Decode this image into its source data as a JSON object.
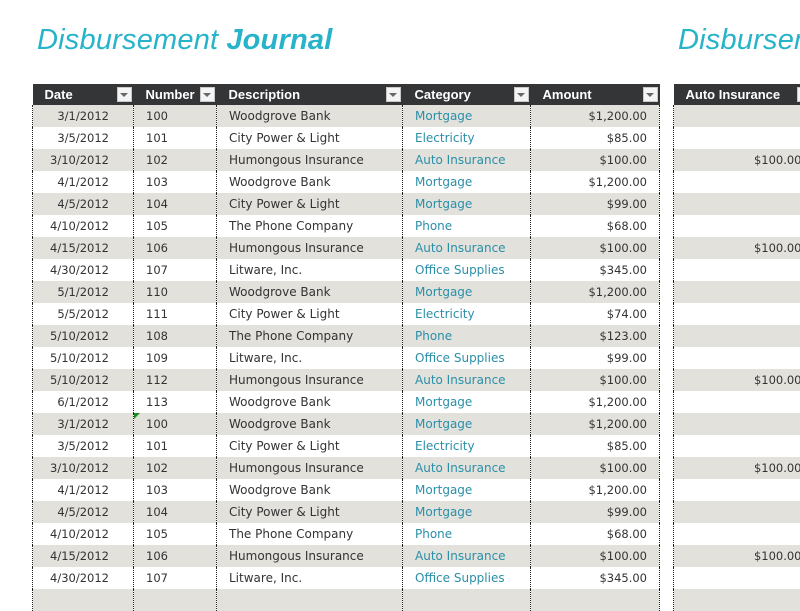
{
  "title": {
    "light": "Disbursement",
    "bold": "Journal"
  },
  "title_second": {
    "light": "Disbursement",
    "bold": ""
  },
  "journal": {
    "columns": [
      "Date",
      "Number",
      "Description",
      "Category",
      "Amount"
    ],
    "rows": [
      {
        "date": "3/1/2012",
        "number": "100",
        "description": "Woodgrove Bank",
        "category": "Mortgage",
        "amount": "$1,200.00"
      },
      {
        "date": "3/5/2012",
        "number": "101",
        "description": "City Power & Light",
        "category": "Electricity",
        "amount": "$85.00"
      },
      {
        "date": "3/10/2012",
        "number": "102",
        "description": "Humongous Insurance",
        "category": "Auto Insurance",
        "amount": "$100.00"
      },
      {
        "date": "4/1/2012",
        "number": "103",
        "description": "Woodgrove Bank",
        "category": "Mortgage",
        "amount": "$1,200.00"
      },
      {
        "date": "4/5/2012",
        "number": "104",
        "description": "City Power & Light",
        "category": "Mortgage",
        "amount": "$99.00"
      },
      {
        "date": "4/10/2012",
        "number": "105",
        "description": "The Phone Company",
        "category": "Phone",
        "amount": "$68.00"
      },
      {
        "date": "4/15/2012",
        "number": "106",
        "description": "Humongous Insurance",
        "category": "Auto Insurance",
        "amount": "$100.00"
      },
      {
        "date": "4/30/2012",
        "number": "107",
        "description": "Litware, Inc.",
        "category": "Office Supplies",
        "amount": "$345.00"
      },
      {
        "date": "5/1/2012",
        "number": "110",
        "description": "Woodgrove Bank",
        "category": "Mortgage",
        "amount": "$1,200.00"
      },
      {
        "date": "5/5/2012",
        "number": "111",
        "description": "City Power & Light",
        "category": "Electricity",
        "amount": "$74.00"
      },
      {
        "date": "5/10/2012",
        "number": "108",
        "description": "The Phone Company",
        "category": "Phone",
        "amount": "$123.00"
      },
      {
        "date": "5/10/2012",
        "number": "109",
        "description": "Litware, Inc.",
        "category": "Office Supplies",
        "amount": "$99.00"
      },
      {
        "date": "5/10/2012",
        "number": "112",
        "description": "Humongous Insurance",
        "category": "Auto Insurance",
        "amount": "$100.00"
      },
      {
        "date": "6/1/2012",
        "number": "113",
        "description": "Woodgrove Bank",
        "category": "Mortgage",
        "amount": "$1,200.00"
      },
      {
        "date": "3/1/2012",
        "number": "100",
        "description": "Woodgrove Bank",
        "category": "Mortgage",
        "amount": "$1,200.00",
        "error_flag": true
      },
      {
        "date": "3/5/2012",
        "number": "101",
        "description": "City Power & Light",
        "category": "Electricity",
        "amount": "$85.00"
      },
      {
        "date": "3/10/2012",
        "number": "102",
        "description": "Humongous Insurance",
        "category": "Auto Insurance",
        "amount": "$100.00"
      },
      {
        "date": "4/1/2012",
        "number": "103",
        "description": "Woodgrove Bank",
        "category": "Mortgage",
        "amount": "$1,200.00"
      },
      {
        "date": "4/5/2012",
        "number": "104",
        "description": "City Power & Light",
        "category": "Mortgage",
        "amount": "$99.00"
      },
      {
        "date": "4/10/2012",
        "number": "105",
        "description": "The Phone Company",
        "category": "Phone",
        "amount": "$68.00"
      },
      {
        "date": "4/15/2012",
        "number": "106",
        "description": "Humongous Insurance",
        "category": "Auto Insurance",
        "amount": "$100.00"
      },
      {
        "date": "4/30/2012",
        "number": "107",
        "description": "Litware, Inc.",
        "category": "Office Supplies",
        "amount": "$345.00"
      },
      {
        "date": "",
        "number": "",
        "description": "",
        "category": "",
        "amount": ""
      }
    ]
  },
  "summary": {
    "columns": [
      "Auto Insurance"
    ],
    "values": [
      "",
      "",
      "$100.00",
      "",
      "",
      "",
      "$100.00",
      "",
      "",
      "",
      "",
      "",
      "$100.00",
      "",
      "",
      "",
      "$100.00",
      "",
      "",
      "",
      "$100.00",
      "",
      ""
    ]
  },
  "icons": {
    "filter": "dropdown-arrow-icon",
    "error": "green-triangle-error-icon"
  },
  "colors": {
    "title": "#27b3c9",
    "header_bg": "#333536",
    "band": "#e2e1dc",
    "category_text": "#2a8fa8"
  }
}
